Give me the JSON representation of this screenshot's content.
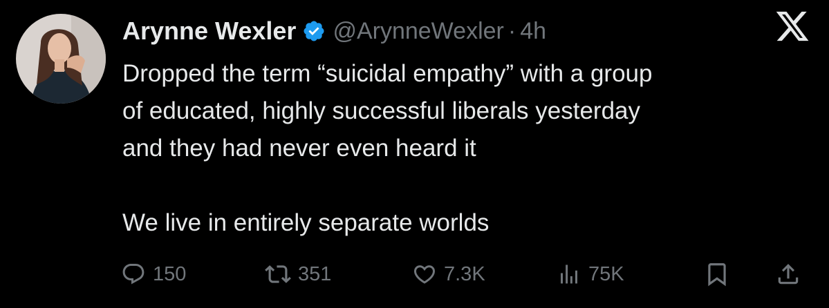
{
  "tweet": {
    "author": {
      "name": "Arynne Wexler",
      "handle": "@ArynneWexler",
      "verified": true,
      "avatar_icon": "profile-photo"
    },
    "separator": "·",
    "time": "4h",
    "platform_icon": "x-logo-icon",
    "text": {
      "paragraph_1_line_1": "Dropped the term “suicidal empathy” with a group",
      "paragraph_1_line_2": "of educated, highly successful liberals yesterday",
      "paragraph_1_line_3": "and they had never even heard it",
      "paragraph_2": "We live in entirely separate worlds"
    },
    "actions": {
      "replies": "150",
      "reposts": "351",
      "likes": "7.3K",
      "views": "75K"
    }
  },
  "colors": {
    "background": "#000000",
    "primary_text": "#e7e9ea",
    "secondary_text": "#71767b",
    "verified_badge": "#1d9bf0"
  }
}
